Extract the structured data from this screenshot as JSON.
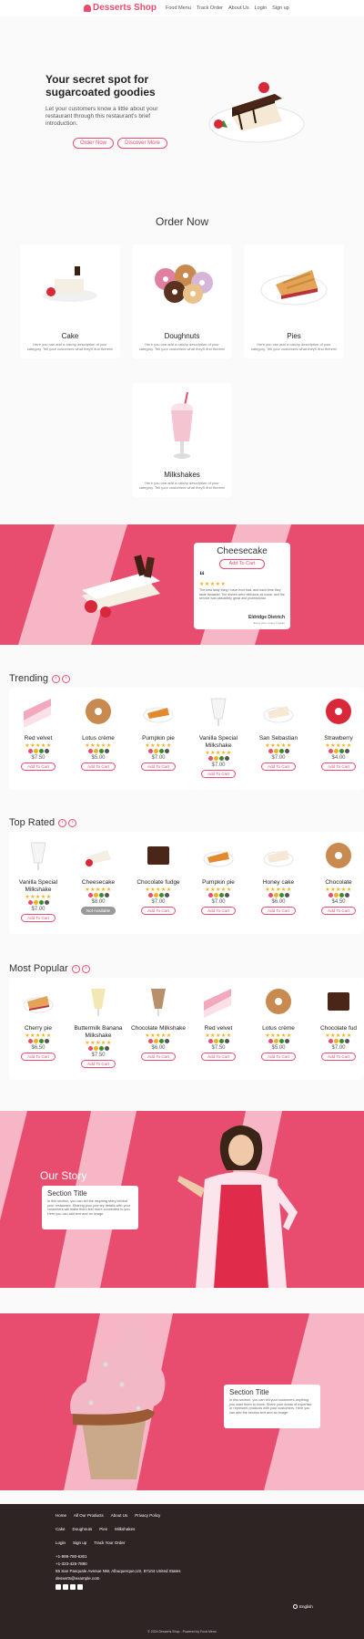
{
  "header": {
    "brand": "Desserts Shop",
    "nav": [
      "Food Menu",
      "Track Order",
      "About Us",
      "Login",
      "Sign up"
    ]
  },
  "hero": {
    "title_line1": "Your secret spot for",
    "title_line2": "sugarcoated goodies",
    "description": "Let your customers know a little about your restaurant through this restaurant's brief introduction.",
    "order_btn": "Order Now",
    "discover_btn": "Discover More"
  },
  "order_now": {
    "title": "Order Now",
    "categories": [
      {
        "name": "Cake",
        "desc": "Here you can add a catchy description of your category. Tell your customers what they'll find therein!"
      },
      {
        "name": "Doughnuts",
        "desc": "Here you can add a catchy description of your category. Tell your customers what they'll find therein!"
      },
      {
        "name": "Pies",
        "desc": "Here you can add a catchy description of your category. Tell your customers what they'll find therein!"
      },
      {
        "name": "Milkshakes",
        "desc": "Here you can add a catchy description of your category. Tell your customers what they'll find therein!"
      }
    ]
  },
  "featured": {
    "name": "Cheesecake",
    "btn": "Add To Cart",
    "review": "The best tasty thing I have ever had, and each time they taste fantastic! The dishes were delicious as usual, and the service was absolutely great and professional.",
    "author": "Eldridge Dietrich",
    "author_sub": "Every time I enjoy it again"
  },
  "trending": {
    "title": "Trending",
    "items": [
      {
        "name": "Red velvet",
        "price": "$7.50",
        "btn": "Add To Cart"
      },
      {
        "name": "Lotus crème",
        "price": "$5.00",
        "btn": "Add To Cart"
      },
      {
        "name": "Pumpkin pie",
        "price": "$7.00",
        "btn": "Add To Cart"
      },
      {
        "name": "Vanilla Special Milkshake",
        "price": "$7.00",
        "btn": "Add To Cart"
      },
      {
        "name": "San Sebastian",
        "price": "$7.00",
        "btn": "Add To Cart"
      },
      {
        "name": "Strawberry",
        "price": "$4.00",
        "btn": "Add To Cart"
      }
    ]
  },
  "top_rated": {
    "title": "Top Rated",
    "items": [
      {
        "name": "Vanilla Special Milkshake",
        "price": "$7.00",
        "btn": "Add To Cart"
      },
      {
        "name": "Cheesecake",
        "price": "$8.00",
        "btn": "Not Available"
      },
      {
        "name": "Chocolate fudge",
        "price": "$7.00",
        "btn": "Add To Cart"
      },
      {
        "name": "Pumpkin pie",
        "price": "$7.00",
        "btn": "Add To Cart"
      },
      {
        "name": "Honey cake",
        "price": "$6.00",
        "btn": "Add To Cart"
      },
      {
        "name": "Chocolate",
        "price": "$4.50",
        "btn": "Add To Cart"
      }
    ]
  },
  "most_popular": {
    "title": "Most Popular",
    "items": [
      {
        "name": "Cherry pie",
        "price": "$6.50",
        "btn": "Add To Cart"
      },
      {
        "name": "Buttermilk Banana Milkshake",
        "price": "$7.50",
        "btn": "Add To Cart"
      },
      {
        "name": "Chocolate Milkshake",
        "price": "$6.00",
        "btn": "Add To Cart"
      },
      {
        "name": "Red velvet",
        "price": "$7.50",
        "btn": "Add To Cart"
      },
      {
        "name": "Lotus crème",
        "price": "$5.00",
        "btn": "Add To Cart"
      },
      {
        "name": "Chocolate fud",
        "price": "$7.00",
        "btn": "Add To Cart"
      }
    ]
  },
  "story": {
    "heading": "Our Story",
    "section_title": "Section Title",
    "text": "In this section, you can tell the inspiring story behind your restaurant. Sharing your journey details with your customers will make them feel more connected to you. Here you can add text and an image."
  },
  "story2": {
    "section_title": "Section Title",
    "text": "In this section, you can tell your customers anything you want them to know. Share your areas of expertise or represent products with your customers. Here you can add the section text and an image."
  },
  "footer": {
    "row1": [
      "Home",
      "All Our Products",
      "About Us",
      "Privacy Policy"
    ],
    "row2": [
      "Cake",
      "Doughnuts",
      "Pies",
      "Milkshakes"
    ],
    "row3": [
      "Login",
      "Sign up",
      "Track Your Order"
    ],
    "phone1": "+1-999-780-6301",
    "phone2": "+1-323-426-7880",
    "address": "55 San Pasquale Avenue NW, Albuquerque,US, 87104 United States",
    "email": "desserts@example.com",
    "language": "English",
    "copyright": "© 2024 Desserts Shop - Powered by Food Menu"
  },
  "colors": {
    "accent": "#e84d6f",
    "light_pink": "#f7b6c5",
    "footer": "#2e2424"
  }
}
